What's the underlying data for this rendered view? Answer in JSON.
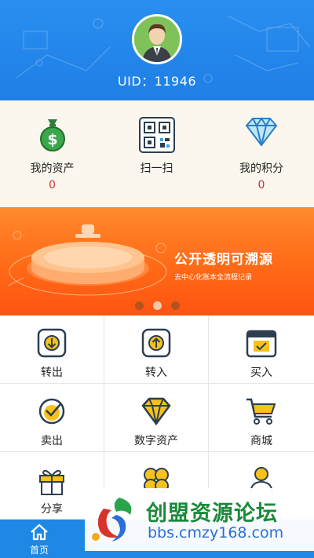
{
  "header": {
    "uid_text": "UID：11946"
  },
  "stats": [
    {
      "label": "我的资产",
      "value": "0",
      "icon": "money-bag-icon"
    },
    {
      "label": "扫一扫",
      "icon": "qr-scan-icon"
    },
    {
      "label": "我的积分",
      "value": "0",
      "icon": "diamond-icon"
    }
  ],
  "banner": {
    "title": "公开透明可溯源",
    "subtitle": "去中心化账本全流程记录",
    "slides": 3,
    "active_slide": 1
  },
  "grid": [
    {
      "label": "转出",
      "icon": "arrow-down-icon"
    },
    {
      "label": "转入",
      "icon": "arrow-up-icon"
    },
    {
      "label": "买入",
      "icon": "calendar-check-icon"
    },
    {
      "label": "卖出",
      "icon": "check-circle-icon"
    },
    {
      "label": "数字资产",
      "icon": "gem-icon"
    },
    {
      "label": "商城",
      "icon": "cart-icon"
    },
    {
      "label": "分享",
      "icon": "gift-icon"
    },
    {
      "label": "",
      "icon": "clover-icon"
    },
    {
      "label": "",
      "icon": "user-icon"
    }
  ],
  "tabbar": [
    {
      "label": "首页",
      "icon": "home-icon"
    }
  ],
  "watermark": {
    "title": "创盟资源论坛",
    "url": "bbs.cmzy168.com"
  },
  "colors": {
    "header_blue": "#1e7fe6",
    "accent_yellow": "#f6c21b",
    "value_red": "#c9302c",
    "banner_orange": "#ff6a16",
    "tabbar_blue": "#1e88e5"
  }
}
